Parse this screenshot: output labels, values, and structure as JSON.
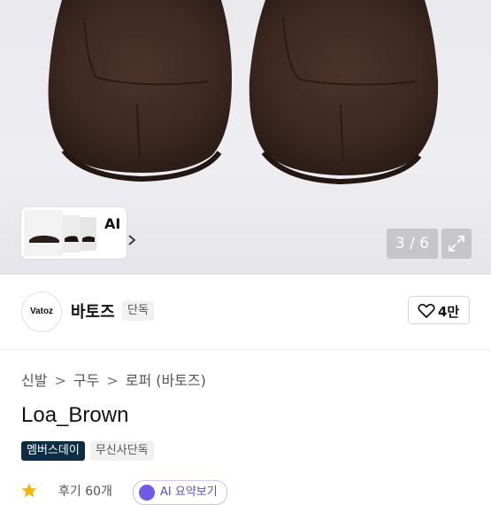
{
  "gallery": {
    "ai_label": "AI",
    "counter": "3 / 6"
  },
  "brand": {
    "logo_text": "Vatoz",
    "name": "바토즈",
    "badge": "단독",
    "likes": "4만"
  },
  "breadcrumb": [
    "신발",
    "구두",
    "로퍼 (바토즈)"
  ],
  "product": {
    "title": "Loa_Brown",
    "tags": [
      "멤버스데이",
      "무신사단독"
    ]
  },
  "rating": {
    "score": "",
    "reviews": "후기 60개",
    "ai_pill": "AI 요약보기"
  },
  "colors": {
    "shoe_brown": "#3d2a22",
    "tag_dark": "#0d2d45",
    "ai_accent": "#6d5ce8"
  }
}
